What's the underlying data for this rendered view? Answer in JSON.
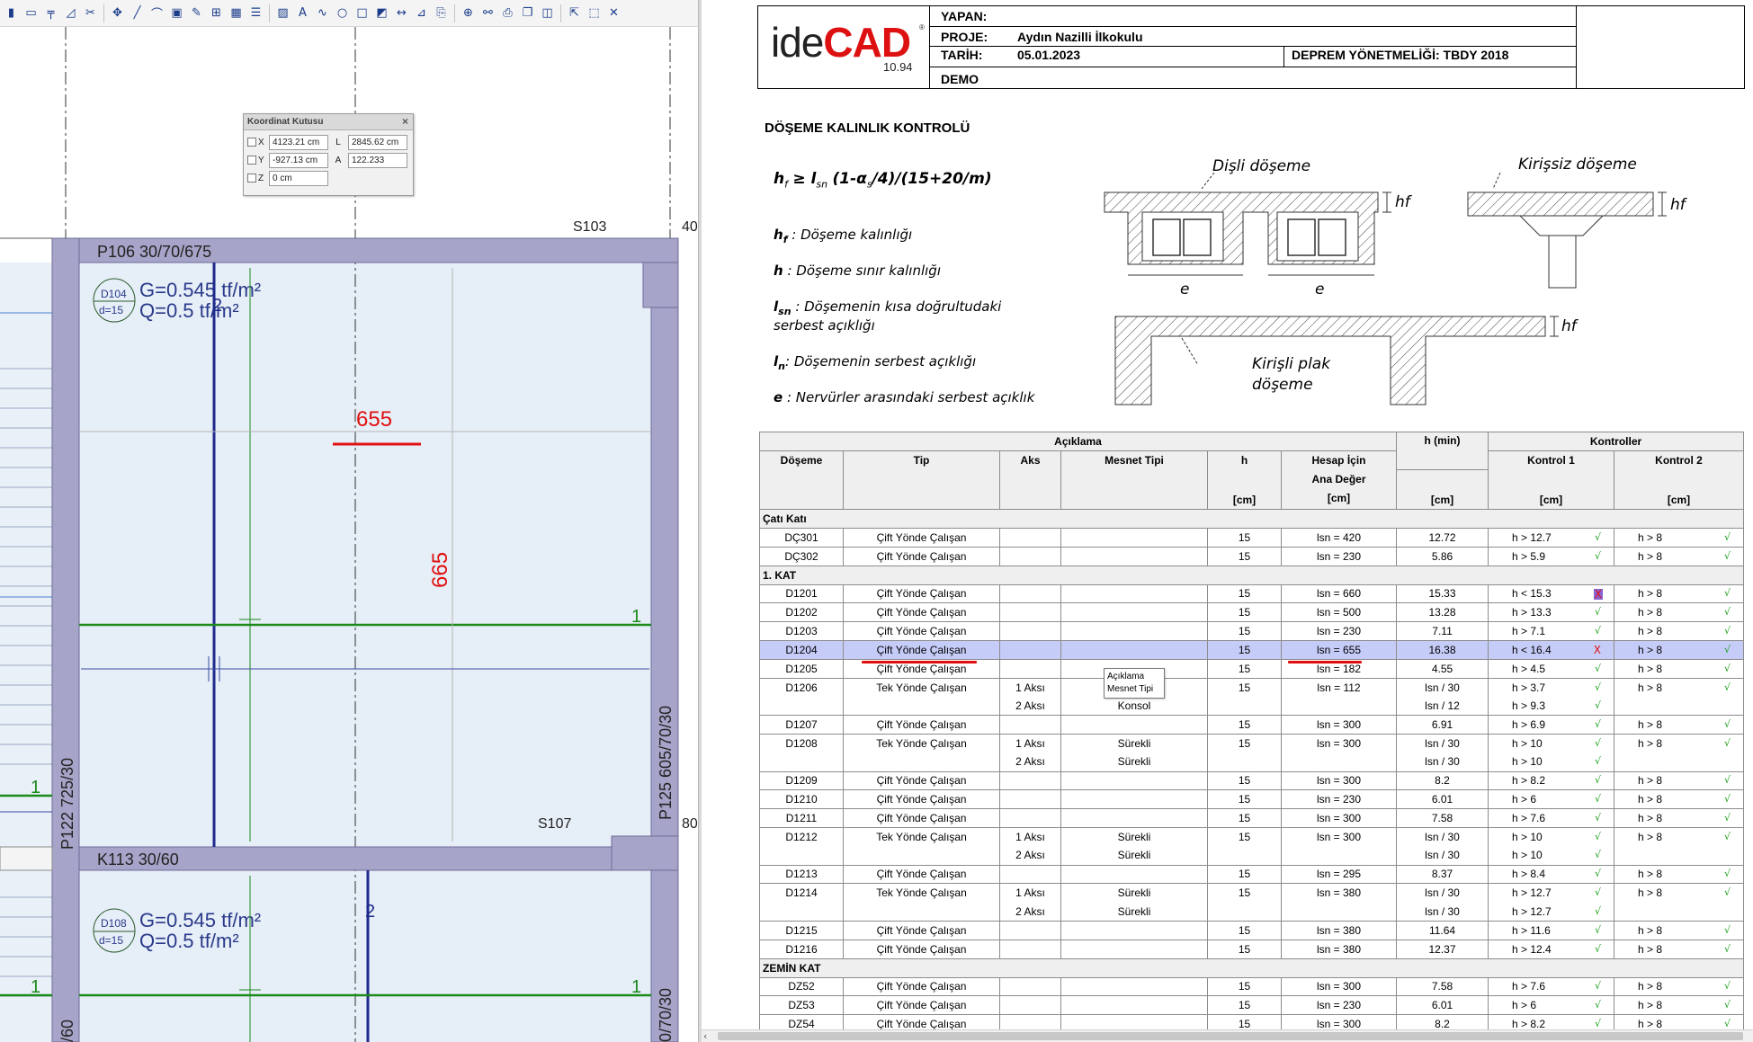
{
  "cad": {
    "toolbar_icons": [
      "column-icon",
      "wall-icon",
      "beam-icon",
      "stair-icon",
      "cut-icon",
      "move-icon",
      "line-icon",
      "arc-icon",
      "frame-icon",
      "brush-icon",
      "grid-icon",
      "table-icon",
      "list-icon",
      "image-icon",
      "text-icon",
      "wave-icon",
      "circle-icon",
      "rectangle-icon",
      "hatch-icon",
      "dimension-icon",
      "level-icon",
      "paste-icon",
      "zoom-icon",
      "link-icon",
      "plot-icon",
      "window-icon",
      "panel-icon",
      "arrow-icon",
      "select-icon",
      "clear-icon"
    ],
    "coord_box": {
      "title": "Koordinat Kutusu",
      "x_label": "X",
      "x_value": "4123.21 cm",
      "y_label": "Y",
      "y_value": "-927.13 cm",
      "z_label": "Z",
      "z_value": "0 cm",
      "l_label": "L",
      "l_value": "2845.62 cm",
      "a_label": "A",
      "a_value": "122.233"
    },
    "labels": {
      "beam_top": "P106 30/70/675",
      "beam_mid": "K113 30/60",
      "col_left": "P122 725/30",
      "col_right": "P125 605/70/30",
      "col_right_bottom": "0/70/30",
      "col_left_bottom": "/60",
      "slab_s103": "S103",
      "slab_s107": "S107",
      "edge_40": "40",
      "edge_80": "80",
      "dim_655": "655",
      "dim_665": "665",
      "axis_2_top": "2",
      "axis_2_bottom": "2",
      "axis_1_a": "1",
      "axis_1_b": "1",
      "axis_1_c": "1",
      "axis_1_d": "1"
    },
    "slab_top": {
      "name": "D104",
      "thickness": "d=15",
      "g": "G=0.545 tf/m²",
      "q": "Q=0.5 tf/m²"
    },
    "slab_bottom": {
      "name": "D108",
      "thickness": "d=15",
      "g": "G=0.545 tf/m²",
      "q": "Q=0.5 tf/m²"
    }
  },
  "report": {
    "logo": {
      "ide": "ide",
      "cad": "CAD",
      "reg": "®",
      "version": "10.94"
    },
    "header": {
      "yapan_label": "YAPAN:",
      "proje_label": "PROJE:",
      "proje_value": "Aydın Nazilli İlkokulu",
      "tarih_label": "TARİH:",
      "tarih_value": "05.01.2023",
      "deprem": "DEPREM YÖNETMELİĞİ: TBDY 2018",
      "demo": "DEMO"
    },
    "title": "DÖŞEME KALINLIK KONTROLÜ",
    "definitions": [
      {
        "sym": "h",
        "sub": "f",
        "text": " : Döşeme kalınlığı"
      },
      {
        "sym": "h",
        "sub": "",
        "text": " : Döşeme sınır kalınlığı"
      },
      {
        "sym": "l",
        "sub": "sn",
        "text": " : Döşemenin kısa doğrultudaki"
      },
      {
        "sym": "",
        "sub": "",
        "text": "serbest açıklığı"
      },
      {
        "sym": "l",
        "sub": "n",
        "text": ": Döşemenin serbest açıklığı"
      },
      {
        "sym": "e",
        "sub": "",
        "text": " : Nervürler arasındaki serbest açıklık"
      }
    ],
    "diagram": {
      "disli": "Dişli döşeme",
      "kirissiz": "Kirişsiz döşeme",
      "kirisli_1": "Kirişli plak",
      "kirisli_2": "döşeme",
      "hf": "hf",
      "e": "e"
    },
    "table": {
      "group_aciklama": "Açıklama",
      "group_hmin": "h (min)",
      "group_kontroller": "Kontroller",
      "col_doseme": "Döşeme",
      "col_tip": "Tip",
      "col_aks": "Aks",
      "col_mesnet": "Mesnet Tipi",
      "col_h": "h",
      "col_hesap_1": "Hesap İçin",
      "col_hesap_2": "Ana Değer",
      "col_k1": "Kontrol 1",
      "col_k2": "Kontrol 2",
      "unit_cm": "[cm]",
      "rows": [
        {
          "type": "section",
          "label": "Çatı Katı"
        },
        {
          "d": "DÇ301",
          "tip": "Çift Yönde Çalışan",
          "aks": "",
          "mesnet": "",
          "h": "15",
          "lsn": "lsn = 420",
          "hmin": "12.72",
          "k1": "h > 12.7",
          "k1s": "ok",
          "k2": "h > 8",
          "k2s": "ok"
        },
        {
          "d": "DÇ302",
          "tip": "Çift Yönde Çalışan",
          "aks": "",
          "mesnet": "",
          "h": "15",
          "lsn": "lsn = 230",
          "hmin": "5.86",
          "k1": "h > 5.9",
          "k1s": "ok",
          "k2": "h > 8",
          "k2s": "ok"
        },
        {
          "type": "section",
          "label": "1. KAT"
        },
        {
          "d": "D1201",
          "tip": "Çift Yönde Çalışan",
          "aks": "",
          "mesnet": "",
          "h": "15",
          "lsn": "lsn = 660",
          "hmin": "15.33",
          "k1": "h < 15.3",
          "k1s": "badhl",
          "k2": "h > 8",
          "k2s": "ok"
        },
        {
          "d": "D1202",
          "tip": "Çift Yönde Çalışan",
          "aks": "",
          "mesnet": "",
          "h": "15",
          "lsn": "lsn = 500",
          "hmin": "13.28",
          "k1": "h > 13.3",
          "k1s": "ok",
          "k2": "h > 8",
          "k2s": "ok"
        },
        {
          "d": "D1203",
          "tip": "Çift Yönde Çalışan",
          "aks": "",
          "mesnet": "",
          "h": "15",
          "lsn": "lsn = 230",
          "hmin": "7.11",
          "k1": "h > 7.1",
          "k1s": "ok",
          "k2": "h > 8",
          "k2s": "ok"
        },
        {
          "d": "D1204",
          "tip": "Çift Yönde Çalışan",
          "aks": "",
          "mesnet": "",
          "h": "15",
          "lsn": "lsn = 655",
          "hmin": "16.38",
          "k1": "h < 16.4",
          "k1s": "bad",
          "k2": "h > 8",
          "k2s": "ok",
          "sel": true
        },
        {
          "d": "D1205",
          "tip": "Çift Yönde Çalışan",
          "aks": "",
          "mesnet": "",
          "h": "15",
          "lsn": "lsn = 182",
          "hmin": "4.55",
          "k1": "h > 4.5",
          "k1s": "ok",
          "k2": "h > 8",
          "k2s": "ok"
        },
        {
          "d": "D1206",
          "tip": "Tek Yönde Çalışan",
          "aks": "1 Aksı",
          "mesnet": "",
          "h": "15",
          "lsn": "lsn = 112",
          "hmin": "lsn / 30",
          "k1": "h > 3.7",
          "k1s": "ok",
          "k2": "h > 8",
          "k2s": "ok"
        },
        {
          "d": "",
          "tip": "",
          "aks": "2 Aksı",
          "mesnet": "Konsol",
          "h": "",
          "lsn": "",
          "hmin": "lsn / 12",
          "k1": "h > 9.3",
          "k1s": "ok",
          "k2": "",
          "k2s": ""
        },
        {
          "d": "D1207",
          "tip": "Çift Yönde Çalışan",
          "aks": "",
          "mesnet": "",
          "h": "15",
          "lsn": "lsn = 300",
          "hmin": "6.91",
          "k1": "h > 6.9",
          "k1s": "ok",
          "k2": "h > 8",
          "k2s": "ok"
        },
        {
          "d": "D1208",
          "tip": "Tek Yönde Çalışan",
          "aks": "1 Aksı",
          "mesnet": "Sürekli",
          "h": "15",
          "lsn": "lsn = 300",
          "hmin": "lsn / 30",
          "k1": "h > 10",
          "k1s": "ok",
          "k2": "h > 8",
          "k2s": "ok"
        },
        {
          "d": "",
          "tip": "",
          "aks": "2 Aksı",
          "mesnet": "Sürekli",
          "h": "",
          "lsn": "",
          "hmin": "lsn / 30",
          "k1": "h > 10",
          "k1s": "ok",
          "k2": "",
          "k2s": ""
        },
        {
          "d": "D1209",
          "tip": "Çift Yönde Çalışan",
          "aks": "",
          "mesnet": "",
          "h": "15",
          "lsn": "lsn = 300",
          "hmin": "8.2",
          "k1": "h > 8.2",
          "k1s": "ok",
          "k2": "h > 8",
          "k2s": "ok"
        },
        {
          "d": "D1210",
          "tip": "Çift Yönde Çalışan",
          "aks": "",
          "mesnet": "",
          "h": "15",
          "lsn": "lsn = 230",
          "hmin": "6.01",
          "k1": "h > 6",
          "k1s": "ok",
          "k2": "h > 8",
          "k2s": "ok"
        },
        {
          "d": "D1211",
          "tip": "Çift Yönde Çalışan",
          "aks": "",
          "mesnet": "",
          "h": "15",
          "lsn": "lsn = 300",
          "hmin": "7.58",
          "k1": "h > 7.6",
          "k1s": "ok",
          "k2": "h > 8",
          "k2s": "ok"
        },
        {
          "d": "D1212",
          "tip": "Tek Yönde Çalışan",
          "aks": "1 Aksı",
          "mesnet": "Sürekli",
          "h": "15",
          "lsn": "lsn = 300",
          "hmin": "lsn / 30",
          "k1": "h > 10",
          "k1s": "ok",
          "k2": "h > 8",
          "k2s": "ok"
        },
        {
          "d": "",
          "tip": "",
          "aks": "2 Aksı",
          "mesnet": "Sürekli",
          "h": "",
          "lsn": "",
          "hmin": "lsn / 30",
          "k1": "h > 10",
          "k1s": "ok",
          "k2": "",
          "k2s": ""
        },
        {
          "d": "D1213",
          "tip": "Çift Yönde Çalışan",
          "aks": "",
          "mesnet": "",
          "h": "15",
          "lsn": "lsn = 295",
          "hmin": "8.37",
          "k1": "h > 8.4",
          "k1s": "ok",
          "k2": "h > 8",
          "k2s": "ok"
        },
        {
          "d": "D1214",
          "tip": "Tek Yönde Çalışan",
          "aks": "1 Aksı",
          "mesnet": "Sürekli",
          "h": "15",
          "lsn": "lsn = 380",
          "hmin": "lsn / 30",
          "k1": "h > 12.7",
          "k1s": "ok",
          "k2": "h > 8",
          "k2s": "ok"
        },
        {
          "d": "",
          "tip": "",
          "aks": "2 Aksı",
          "mesnet": "Sürekli",
          "h": "",
          "lsn": "",
          "hmin": "lsn / 30",
          "k1": "h > 12.7",
          "k1s": "ok",
          "k2": "",
          "k2s": ""
        },
        {
          "d": "D1215",
          "tip": "Çift Yönde Çalışan",
          "aks": "",
          "mesnet": "",
          "h": "15",
          "lsn": "lsn = 380",
          "hmin": "11.64",
          "k1": "h > 11.6",
          "k1s": "ok",
          "k2": "h > 8",
          "k2s": "ok"
        },
        {
          "d": "D1216",
          "tip": "Çift Yönde Çalışan",
          "aks": "",
          "mesnet": "",
          "h": "15",
          "lsn": "lsn = 380",
          "hmin": "12.37",
          "k1": "h > 12.4",
          "k1s": "ok",
          "k2": "h > 8",
          "k2s": "ok"
        },
        {
          "type": "section",
          "label": "ZEMİN KAT"
        },
        {
          "d": "DZ52",
          "tip": "Çift Yönde Çalışan",
          "aks": "",
          "mesnet": "",
          "h": "15",
          "lsn": "lsn = 300",
          "hmin": "7.58",
          "k1": "h > 7.6",
          "k1s": "ok",
          "k2": "h > 8",
          "k2s": "ok"
        },
        {
          "d": "DZ53",
          "tip": "Çift Yönde Çalışan",
          "aks": "",
          "mesnet": "",
          "h": "15",
          "lsn": "lsn = 230",
          "hmin": "6.01",
          "k1": "h > 6",
          "k1s": "ok",
          "k2": "h > 8",
          "k2s": "ok"
        },
        {
          "d": "DZ54",
          "tip": "Çift Yönde Çalışan",
          "aks": "",
          "mesnet": "",
          "h": "15",
          "lsn": "lsn = 300",
          "hmin": "8.2",
          "k1": "h > 8.2",
          "k1s": "ok",
          "k2": "h > 8",
          "k2s": "ok"
        }
      ],
      "status_glyphs": {
        "ok": "√",
        "bad": "X",
        "badhl": "X"
      }
    },
    "tooltip": {
      "line1": "Açıklama",
      "line2": "Mesnet Tipi"
    }
  }
}
